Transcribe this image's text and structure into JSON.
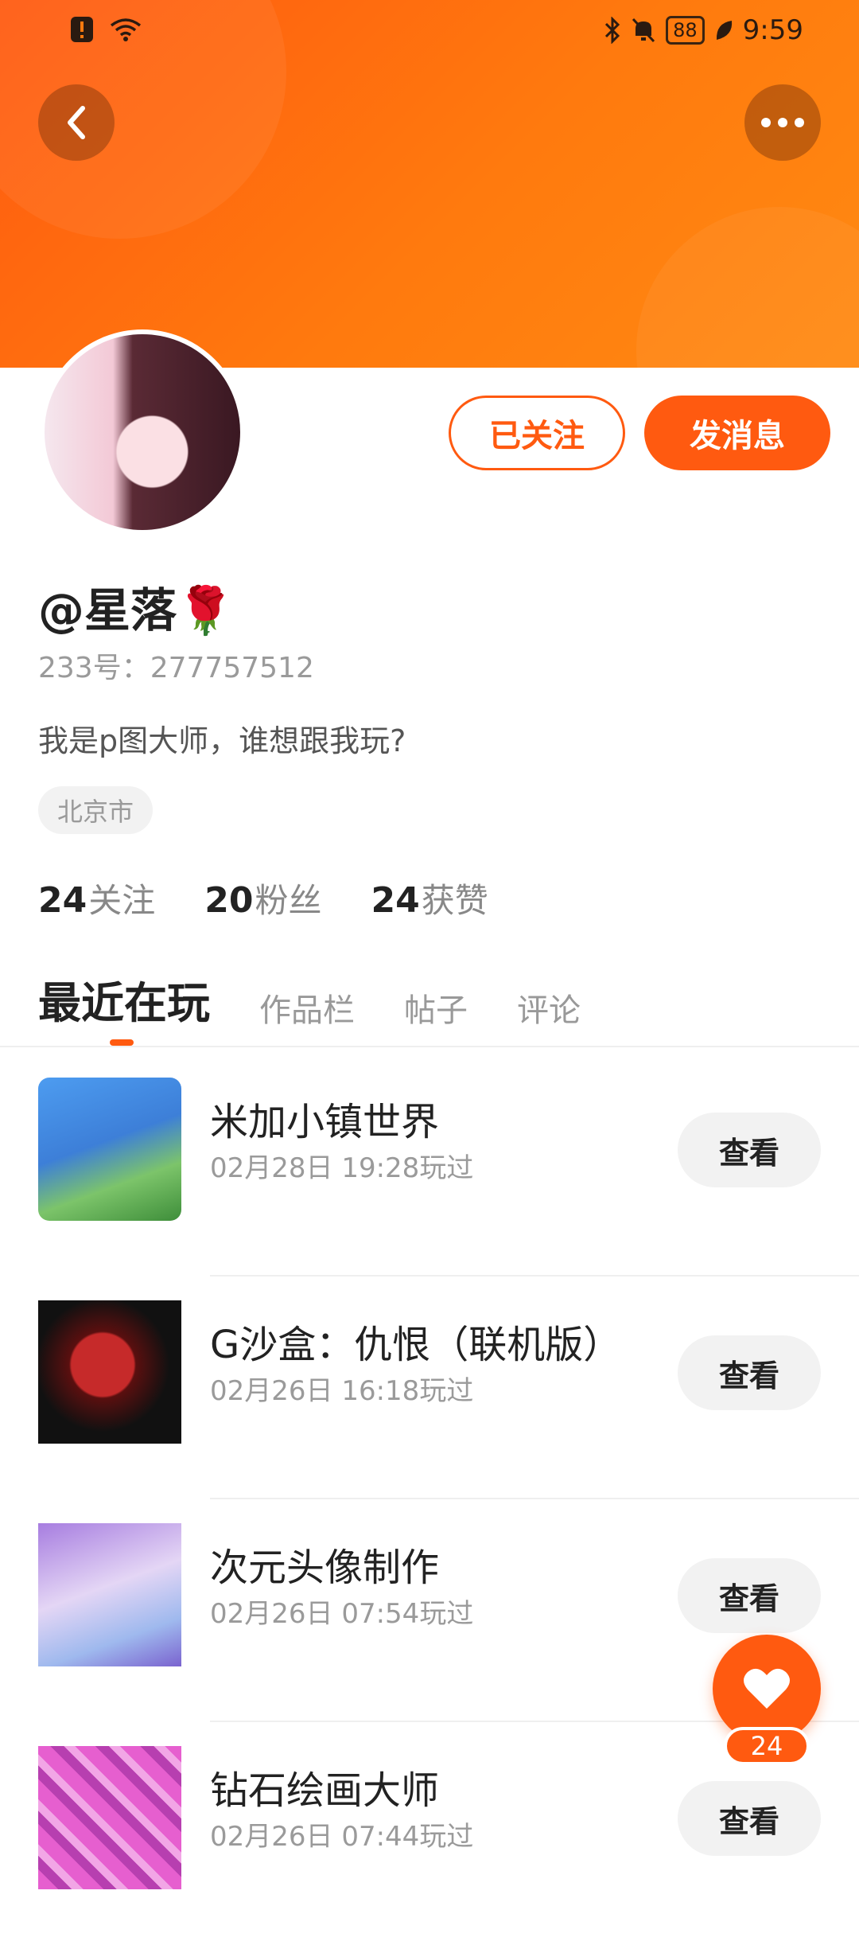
{
  "status_bar": {
    "time": "9:59",
    "battery": "88",
    "icons": [
      "alert-icon",
      "wifi-icon",
      "bluetooth-icon",
      "mute-icon",
      "battery-icon",
      "leaf-icon"
    ]
  },
  "header": {
    "back_icon": "chevron-left-icon",
    "more_icon": "more-dots-icon",
    "accent": "#ff5a10"
  },
  "profile": {
    "nickname": "@星落🌹",
    "uid": "233号：277757512",
    "bio": "我是p图大师，谁想跟我玩?",
    "location": "北京市",
    "follow_label": "已关注",
    "message_label": "发消息"
  },
  "stats": [
    {
      "count": "24",
      "label": "关注"
    },
    {
      "count": "20",
      "label": "粉丝"
    },
    {
      "count": "24",
      "label": "获赞"
    }
  ],
  "tabs": [
    {
      "label": "最近在玩",
      "active": true
    },
    {
      "label": "作品栏",
      "active": false
    },
    {
      "label": "帖子",
      "active": false
    },
    {
      "label": "评论",
      "active": false
    }
  ],
  "games": [
    {
      "name": "米加小镇世界",
      "time": "02月28日 19:28玩过",
      "action": "查看"
    },
    {
      "name": "G沙盒：仇恨（联机版）",
      "time": "02月26日 16:18玩过",
      "action": "查看"
    },
    {
      "name": "次元头像制作",
      "time": "02月26日 07:54玩过",
      "action": "查看"
    },
    {
      "name": "钻石绘画大师",
      "time": "02月26日 07:44玩过",
      "action": "查看"
    }
  ],
  "fab": {
    "icon": "heart-icon",
    "count": "24"
  }
}
